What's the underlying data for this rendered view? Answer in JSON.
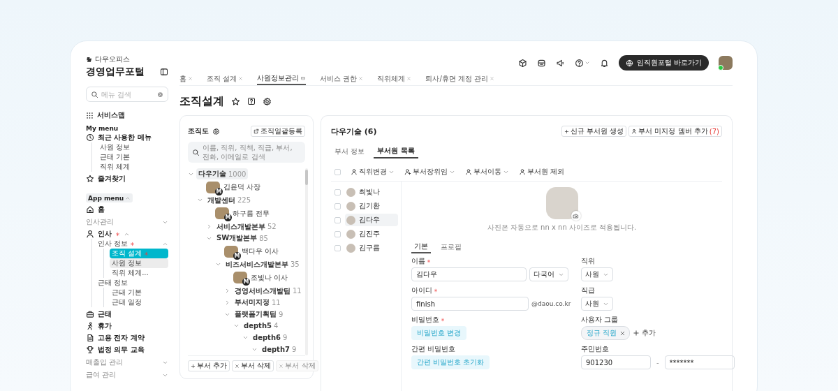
{
  "brand": {
    "company": "다우오피스",
    "title": "경영업무포털"
  },
  "sidebar": {
    "search_placeholder": "메뉴 검색",
    "service_map": "서비스맵",
    "my_menu": {
      "heading": "My menu",
      "recent": {
        "label": "최근 사용한 메뉴",
        "children": [
          "사원 정보",
          "근태 기본",
          "직위 체계"
        ]
      },
      "favorites": "즐겨찾기"
    },
    "app_menu": {
      "heading": "App menu",
      "expanded": true,
      "items": [
        {
          "kind": "link",
          "label": "홈"
        },
        {
          "kind": "category",
          "label": "인사관리",
          "expanded": false
        },
        {
          "kind": "module",
          "label": "인사",
          "alert": true,
          "expanded": true,
          "children": [
            {
              "label": "인사 정보",
              "alert": true,
              "expanded": true,
              "children": [
                {
                  "label": "조직 설계",
                  "alert": true,
                  "selected": true,
                  "hovered": false
                },
                {
                  "label": "사원 정보",
                  "alert": false,
                  "selected": false,
                  "hovered": true
                },
                {
                  "label": "직위 체계...",
                  "alert": false,
                  "selected": false,
                  "hovered": false
                }
              ]
            },
            {
              "label": "근태 정보",
              "alert": false,
              "children": [
                {
                  "label": "근태 기본",
                  "alert": false,
                  "selected": false,
                  "hovered": false
                },
                {
                  "label": "근태 일정",
                  "alert": false,
                  "selected": false,
                  "hovered": false
                }
              ]
            }
          ]
        },
        {
          "kind": "link",
          "label": "근태"
        },
        {
          "kind": "link",
          "label": "휴가"
        },
        {
          "kind": "link",
          "label": "고용 전자 계약"
        },
        {
          "kind": "link",
          "label": "법정 의무 교육"
        },
        {
          "kind": "category",
          "label": "매출입 관리",
          "expanded": false
        },
        {
          "kind": "category",
          "label": "급여 관리",
          "expanded": false
        }
      ]
    }
  },
  "header": {
    "portal_button": "임직원포털 바로가기",
    "user": {
      "online": true
    }
  },
  "tabs": [
    {
      "label": "홈",
      "selected": false
    },
    {
      "label": "조직 설계",
      "selected": false
    },
    {
      "label": "사원정보관리",
      "selected": true
    },
    {
      "label": "서비스 권한",
      "selected": false
    },
    {
      "label": "직위체계",
      "selected": false
    },
    {
      "label": "퇴사/휴면 계정 관리",
      "selected": false
    }
  ],
  "page": {
    "title": "조직설계"
  },
  "org": {
    "title": "조직도",
    "bulk_button": "조직일괄등록",
    "search_placeholder": "이름, 직위, 직책, 직급, 부서, 전화, 이메일로 검색",
    "tree": [
      {
        "kind": "dept",
        "name": "다우기술",
        "count": "1000",
        "expanded": true,
        "selected": true,
        "children": [
          {
            "kind": "person",
            "name": "김윤덕 사장",
            "badge": "M"
          },
          {
            "kind": "dept",
            "name": "개발센터",
            "count": "225",
            "expanded": true,
            "selected": false,
            "children": [
              {
                "kind": "person",
                "name": "하구름 전무",
                "badge": "M"
              },
              {
                "kind": "dept",
                "name": "서비스개발본부",
                "count": "52",
                "expanded": false,
                "selected": false
              },
              {
                "kind": "dept",
                "name": "SW개발본부",
                "count": "85",
                "expanded": true,
                "selected": false,
                "children": [
                  {
                    "kind": "person",
                    "name": "백다우 이사",
                    "badge": "M"
                  },
                  {
                    "kind": "dept",
                    "name": "비즈서비스개발본부",
                    "count": "35",
                    "expanded": true,
                    "selected": false,
                    "children": [
                      {
                        "kind": "person",
                        "name": "조빛나 이사",
                        "badge": "M"
                      },
                      {
                        "kind": "dept",
                        "name": "경영서비스개발팀",
                        "count": "11",
                        "expanded": false,
                        "selected": false
                      },
                      {
                        "kind": "dept",
                        "name": "부서미지정",
                        "count": "11",
                        "expanded": false,
                        "selected": false
                      },
                      {
                        "kind": "dept",
                        "name": "플랫폼기획팀",
                        "count": "9",
                        "expanded": true,
                        "selected": false,
                        "children": [
                          {
                            "kind": "dept",
                            "name": "depth5",
                            "count": "4",
                            "expanded": true,
                            "selected": false,
                            "children": [
                              {
                                "kind": "dept",
                                "name": "depth6",
                                "count": "9",
                                "expanded": true,
                                "selected": false,
                                "children": [
                                  {
                                    "kind": "dept",
                                    "name": "depth7",
                                    "count": "9",
                                    "expanded": true,
                                    "selected": false
                                  }
                                ]
                              }
                            ]
                          }
                        ]
                      }
                    ]
                  }
                ]
              }
            ]
          }
        ]
      }
    ],
    "actions": [
      {
        "kind": "add",
        "label": "부서 추가",
        "disabled": false
      },
      {
        "kind": "delete",
        "label": "부서 삭제",
        "disabled": false
      },
      {
        "kind": "delete",
        "label": "부서 삭제",
        "disabled": true
      }
    ]
  },
  "dept": {
    "title": "다우기술 (6)",
    "create_button": "신규 부서원 생성",
    "unassigned_button": {
      "label": "부서 미지정 멤버 추가",
      "count": "(7)"
    },
    "tabs": [
      {
        "label": "부서 정보",
        "selected": false
      },
      {
        "label": "부서원 목록",
        "selected": true
      }
    ],
    "select_all": {
      "checked": false
    },
    "toolbar": [
      {
        "label": "직위변경",
        "dropdown": true
      },
      {
        "label": "부서장위임",
        "dropdown": true
      },
      {
        "label": "부서이동",
        "dropdown": true
      },
      {
        "label": "부서원 제외",
        "dropdown": false
      }
    ],
    "members": [
      {
        "name": "최빛나",
        "checked": false,
        "selected": false
      },
      {
        "name": "김기환",
        "checked": false,
        "selected": false
      },
      {
        "name": "김다우",
        "checked": false,
        "selected": true
      },
      {
        "name": "김진주",
        "checked": false,
        "selected": false
      },
      {
        "name": "김구름",
        "checked": false,
        "selected": false
      }
    ],
    "detail": {
      "photo_hint": "사진은 자동으로 nn x nn 사이즈로 적용됩니다.",
      "tabs": [
        {
          "label": "기본",
          "selected": true
        },
        {
          "label": "프로필",
          "selected": false
        }
      ],
      "name": {
        "label": "이름",
        "required": true,
        "value": "김다우",
        "language": "다국어"
      },
      "login_id": {
        "label": "아이디",
        "required": true,
        "value": "finish",
        "domain": "@daou.co.kr"
      },
      "password": {
        "label": "비밀번호",
        "required": true,
        "button": "비밀번호 변경"
      },
      "simple_password": {
        "label": "간편 비밀번호",
        "required": false,
        "button": "간편 비밀번호 초기화"
      },
      "position": {
        "label": "직위",
        "value": "사원"
      },
      "grade": {
        "label": "직급",
        "value": "사원"
      },
      "user_group": {
        "label": "사용자 그룹",
        "chips": [
          "정규 직원"
        ],
        "add_label": "추가"
      },
      "resident_number": {
        "label": "주민번호",
        "front": "901230",
        "separator": "-",
        "back": "*******"
      }
    }
  }
}
